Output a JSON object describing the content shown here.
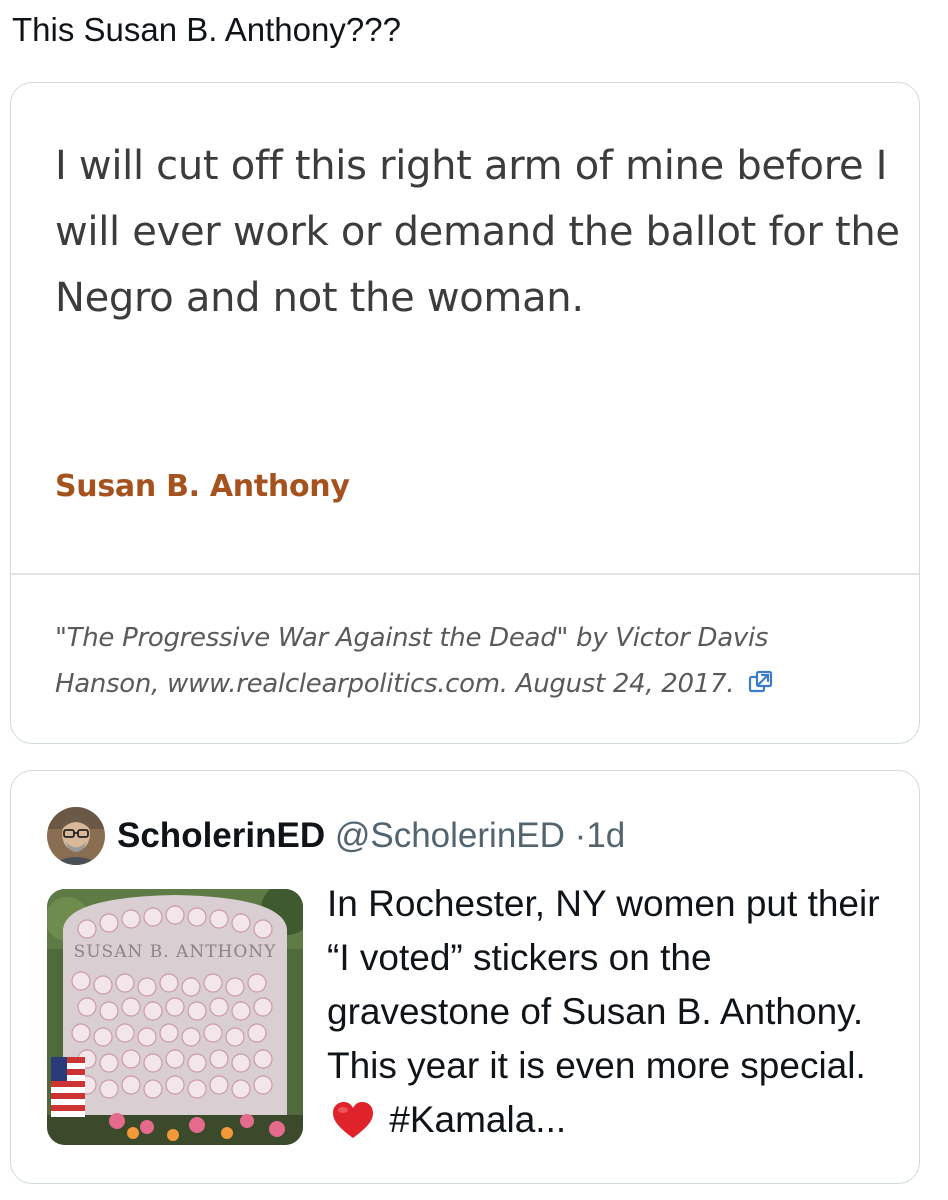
{
  "post": {
    "text": "This Susan B. Anthony???"
  },
  "quote_card": {
    "quote": "I will cut off this right arm of mine before I will ever work or demand the ballot for the Negro and not the woman.",
    "author": "Susan B. Anthony",
    "source": "\"The Progressive War Against the Dead\" by Victor Davis Hanson, www.realclearpolitics.com. August 24, 2017.",
    "icon": "external-link-icon",
    "colors": {
      "author": "#a5521f",
      "quote": "#3c3c3c",
      "source": "#5a5a5a"
    }
  },
  "quoted_tweet": {
    "author_name": "ScholerinED",
    "handle": "@ScholerinED",
    "separator": "·",
    "time": "1d",
    "text_before_emoji": "In Rochester, NY women put their “I voted” stickers on the gravestone of Susan B. Anthony. This year it is even more special.",
    "emoji": "heart-emoji",
    "text_after_emoji": "#Kamala...",
    "media_text": "SUSAN B. ANTHONY"
  }
}
